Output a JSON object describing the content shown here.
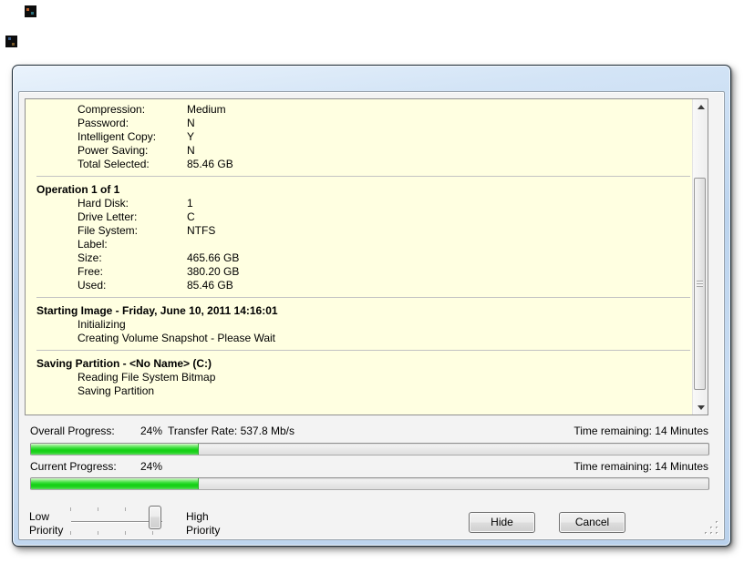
{
  "colors": {
    "log_background": "#ffffe1",
    "progress_green": "#1ed31e",
    "frame_blue": "#c3d9f0",
    "client_background": "#f3f3f3"
  },
  "log": {
    "sections": [
      {
        "rows": [
          {
            "label": "Compression:",
            "value": "Medium"
          },
          {
            "label": "Password:",
            "value": "N"
          },
          {
            "label": "Intelligent Copy:",
            "value": "Y"
          },
          {
            "label": "Power Saving:",
            "value": "N"
          },
          {
            "label": "Total Selected:",
            "value": "85.46 GB"
          }
        ]
      },
      {
        "heading": "Operation 1 of 1",
        "rows": [
          {
            "label": "Hard Disk:",
            "value": "1"
          },
          {
            "label": "Drive Letter:",
            "value": "C"
          },
          {
            "label": "File System:",
            "value": "NTFS"
          },
          {
            "label": "Label:",
            "value": ""
          },
          {
            "label": "Size:",
            "value": "465.66 GB"
          },
          {
            "label": "Free:",
            "value": "380.20 GB"
          },
          {
            "label": "Used:",
            "value": "85.46 GB"
          }
        ]
      },
      {
        "heading": "Starting Image - Friday, June 10, 2011 14:16:01",
        "lines": [
          "Initializing",
          "Creating Volume Snapshot - Please Wait"
        ]
      },
      {
        "heading": "Saving Partition - <No Name> (C:)",
        "lines": [
          "Reading File System Bitmap",
          "Saving Partition"
        ]
      }
    ]
  },
  "progress": {
    "overall": {
      "label": "Overall Progress:",
      "percent_text": "24%",
      "fill_percent": 24.6,
      "transfer": "Transfer Rate: 537.8 Mb/s",
      "time_remaining": "Time remaining: 14 Minutes"
    },
    "current": {
      "label": "Current Progress:",
      "percent_text": "24%",
      "fill_percent": 24.6,
      "time_remaining": "Time remaining: 14 Minutes"
    }
  },
  "priority": {
    "low_line1": "Low",
    "low_line2": "Priority",
    "high_line1": "High",
    "high_line2": "Priority",
    "level": "high"
  },
  "buttons": {
    "hide": "Hide",
    "cancel": "Cancel"
  }
}
